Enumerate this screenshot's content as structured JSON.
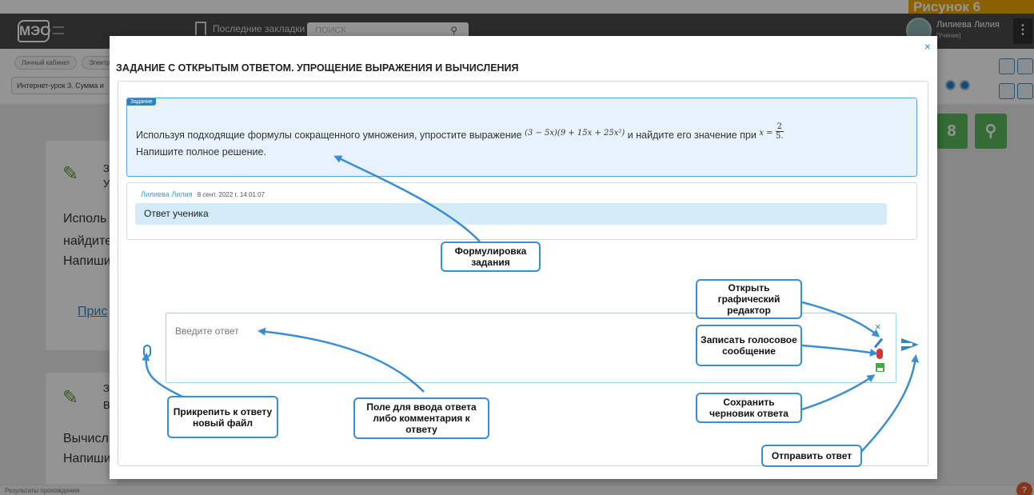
{
  "header": {
    "logo_text": "МЭО",
    "bookmarks_label": "Последние закладки",
    "search_placeholder": "ПОИСК",
    "user_name": "Лилиева Лилия",
    "user_role": "[Ученик]",
    "banner_text": "Рисунок 6"
  },
  "breadcrumbs": [
    "Личный кабинет",
    "Электр"
  ],
  "lesson_selector": "Интернет-урок 3. Сумма и",
  "background": {
    "lines": [
      "Исполь",
      "найдите",
      "Напиши",
      "Прис",
      "Вычисл",
      "Напиши"
    ],
    "fragment_a": "З",
    "fragment_b": "У",
    "fragment_c": "З",
    "fragment_d": "В",
    "green_button_text": "8",
    "status_text": "Результаты прохождения",
    "help_badge": "?"
  },
  "modal": {
    "title": "ЗАДАНИЕ С ОТКРЫТЫМ ОТВЕТОМ. УПРОЩЕНИЕ ВЫРАЖЕНИЯ И ВЫЧИСЛЕНИЯ",
    "close_glyph": "×",
    "task_tag": "Задание",
    "task_text_1": "Используя подходящие формулы сокращенного умножения, упростите выражение",
    "task_expression": "(3 − 5x)(9 + 15x + 25x²)",
    "task_text_2": "и найдите его значение при",
    "task_var": "x =",
    "task_frac_num": "2",
    "task_frac_den": "5.",
    "task_text_3": "Напишите полное решение.",
    "answer_author": "Лилиева Лилия",
    "answer_time": "8 сент. 2022 г. 14:01:07",
    "answer_text": "Ответ ученика",
    "input_placeholder": "Введите ответ",
    "clear_glyph": "×"
  },
  "callouts": {
    "task_wording": "Формулировка задания",
    "open_graphic_editor": "Открыть графический редактор",
    "record_voice": "Записать голосовое сообщение",
    "attach_file": "Прикрепить к ответу новый файл",
    "answer_field": "Поле для ввода ответа либо комментария к ответу",
    "save_draft": "Сохранить черновик ответа",
    "send_answer": "Отправить ответ"
  },
  "colors": {
    "accent": "#3a8dd0",
    "task_bg": "#e8f2fc",
    "answer_bg": "#d3ecf7",
    "green": "#5cb85c",
    "banner": "#f0a500"
  }
}
